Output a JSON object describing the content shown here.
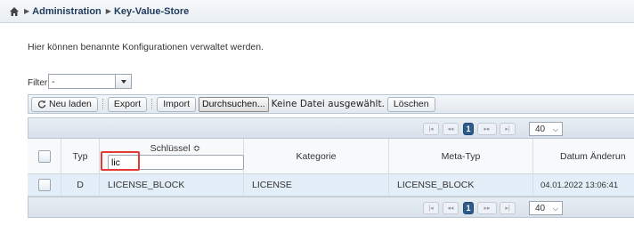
{
  "breadcrumb": {
    "items": [
      "Administration",
      "Key-Value-Store"
    ]
  },
  "description": "Hier können benannte Konfigurationen verwaltet werden.",
  "filter": {
    "label": "Filter",
    "value": "-"
  },
  "toolbar": {
    "reload_label": "Neu laden",
    "export_label": "Export",
    "import_label": "Import",
    "browse_label": "Durchsuchen...",
    "no_file_text": "Keine Datei ausgewählt.",
    "delete_label": "Löschen"
  },
  "pager": {
    "first": "|◂",
    "prev": "◂◂",
    "current_page": "1",
    "next": "▸▸",
    "last": "▸|",
    "page_size": "40"
  },
  "table": {
    "columns": [
      "Typ",
      "Schlüssel ≎",
      "Kategorie",
      "Meta-Typ",
      "Datum Änderun"
    ],
    "search_value": "lic",
    "rows": [
      {
        "typ": "D",
        "schluessel": "LICENSE_BLOCK",
        "kategorie": "LICENSE",
        "meta_typ": "LICENSE_BLOCK",
        "datum": "04.01.2022 13:06:41"
      }
    ]
  },
  "colors": {
    "accent": "#2f5b89",
    "highlight": "#e53935",
    "row_selected": "#e3eef8"
  }
}
